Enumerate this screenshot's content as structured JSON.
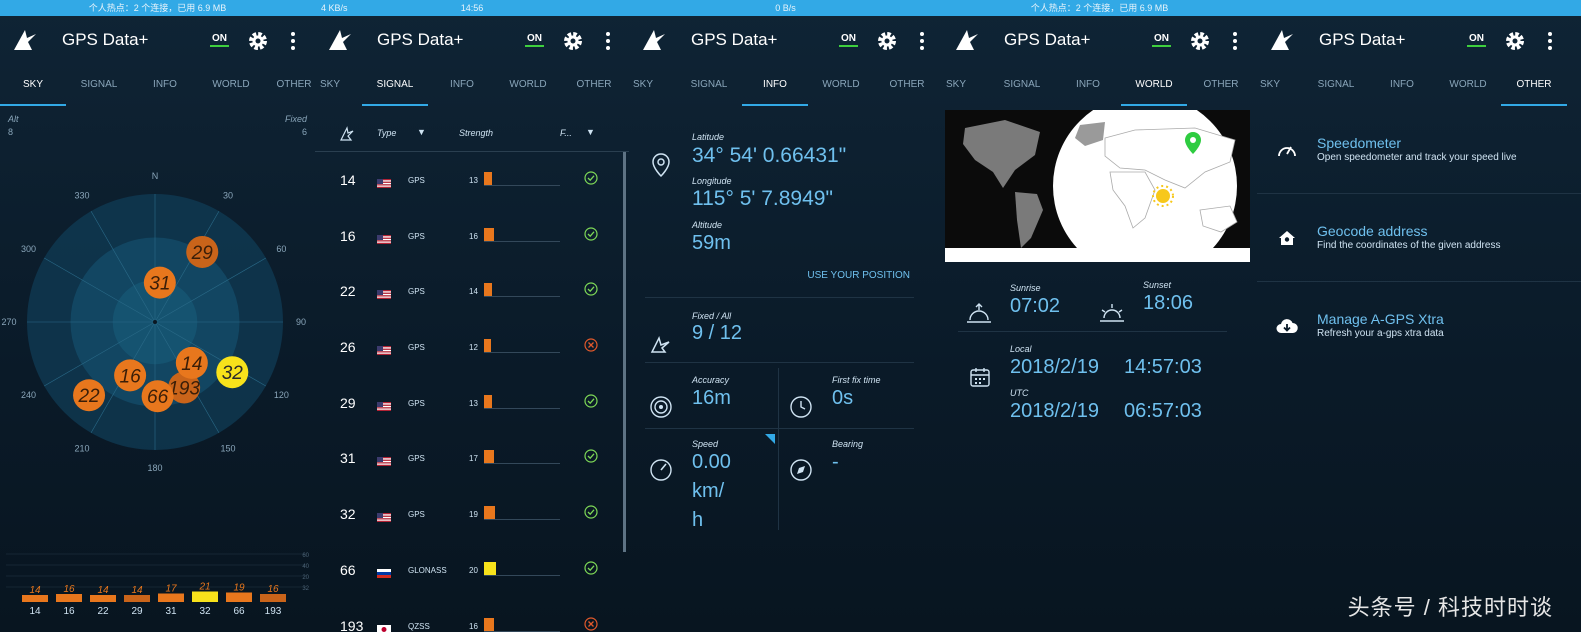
{
  "app": {
    "title": "GPS Data+",
    "on_label": "ON"
  },
  "tabs": [
    "SKY",
    "SIGNAL",
    "INFO",
    "WORLD",
    "OTHER"
  ],
  "status": {
    "hotspot": "个人热点：2 个连接，已用 6.9 MB",
    "speed": "4 KB/s",
    "time": "14:56",
    "speed2": "0 B/s"
  },
  "colors": {
    "accent": "#32a9e6",
    "orange": "#e8771d",
    "yellow": "#f7e21b",
    "green": "#7ed957",
    "red": "#e2592b",
    "bg": "#0a1722"
  },
  "sky": {
    "alt_label": "Alt",
    "alt_value": "8",
    "fixed_label": "Fixed",
    "fixed_value": "6",
    "azimuth_labels": [
      "210",
      "240",
      "270",
      "300",
      "330",
      "N",
      "30",
      "60",
      "90",
      "120",
      "150",
      "180"
    ],
    "satellites": [
      {
        "id": "193",
        "color": "#c9641a",
        "az": 156,
        "elev": 0.56
      },
      {
        "id": "66",
        "color": "#e8771d",
        "az": 178,
        "elev": 0.58
      },
      {
        "id": "16",
        "color": "#e8771d",
        "az": 205,
        "elev": 0.46
      },
      {
        "id": "22",
        "color": "#e8771d",
        "az": 222,
        "elev": 0.77
      },
      {
        "id": "32",
        "color": "#f7e21b",
        "az": 123,
        "elev": 0.72
      },
      {
        "id": "14",
        "color": "#e8771d",
        "az": 138,
        "elev": 0.43
      },
      {
        "id": "31",
        "color": "#e8771d",
        "az": 7,
        "elev": 0.31
      },
      {
        "id": "29",
        "color": "#c9641a",
        "az": 34,
        "elev": 0.66
      }
    ],
    "bar_scale": [
      "60",
      "40",
      "20",
      "32"
    ],
    "bars": [
      {
        "sat": "14",
        "strength": 14,
        "color": "#e8771d"
      },
      {
        "sat": "16",
        "strength": 16,
        "color": "#e8771d"
      },
      {
        "sat": "22",
        "strength": 14,
        "color": "#e8771d"
      },
      {
        "sat": "29",
        "strength": 14,
        "color": "#c9641a"
      },
      {
        "sat": "31",
        "strength": 17,
        "color": "#e8771d"
      },
      {
        "sat": "32",
        "strength": 21,
        "color": "#f7e21b"
      },
      {
        "sat": "66",
        "strength": 19,
        "color": "#e8771d"
      },
      {
        "sat": "193",
        "strength": 16,
        "color": "#c9641a"
      }
    ]
  },
  "signal": {
    "headers": {
      "type": "Type",
      "strength": "Strength",
      "fix": "F..."
    },
    "rows": [
      {
        "id": "14",
        "flag": "us",
        "type": "GPS",
        "strength": 13,
        "used": true,
        "color": "#e8771d"
      },
      {
        "id": "16",
        "flag": "us",
        "type": "GPS",
        "strength": 16,
        "used": true,
        "color": "#e8771d"
      },
      {
        "id": "22",
        "flag": "us",
        "type": "GPS",
        "strength": 14,
        "used": true,
        "color": "#e8771d"
      },
      {
        "id": "26",
        "flag": "us",
        "type": "GPS",
        "strength": 12,
        "used": false,
        "color": "#e8771d"
      },
      {
        "id": "29",
        "flag": "us",
        "type": "GPS",
        "strength": 13,
        "used": true,
        "color": "#e8771d"
      },
      {
        "id": "31",
        "flag": "us",
        "type": "GPS",
        "strength": 17,
        "used": true,
        "color": "#e8771d"
      },
      {
        "id": "32",
        "flag": "us",
        "type": "GPS",
        "strength": 19,
        "used": true,
        "color": "#e8771d"
      },
      {
        "id": "66",
        "flag": "ru",
        "type": "GLONASS",
        "strength": 20,
        "used": true,
        "color": "#f7e21b"
      },
      {
        "id": "193",
        "flag": "jp",
        "type": "QZSS",
        "strength": 16,
        "used": false,
        "color": "#e8771d"
      }
    ]
  },
  "info": {
    "latitude_label": "Latitude",
    "latitude": "34° 54' 0.66431\"",
    "longitude_label": "Longitude",
    "longitude": "115° 5' 7.8949\"",
    "altitude_label": "Altitude",
    "altitude": "59m",
    "use_position": "USE YOUR POSITION",
    "fixed_label": "Fixed / All",
    "fixed_value": "9 / 12",
    "accuracy_label": "Accuracy",
    "accuracy": "16m",
    "first_fix_label": "First fix time",
    "first_fix": "0s",
    "speed_label": "Speed",
    "speed_value": "0.00",
    "speed_unit1": "km/",
    "speed_unit2": "h",
    "bearing_label": "Bearing",
    "bearing": "-"
  },
  "world": {
    "sunrise_label": "Sunrise",
    "sunrise": "07:02",
    "sunset_label": "Sunset",
    "sunset": "18:06",
    "local_label": "Local",
    "local_date": "2018/2/19",
    "local_time": "14:57:03",
    "utc_label": "UTC",
    "utc_date": "2018/2/19",
    "utc_time": "06:57:03"
  },
  "other": [
    {
      "title": "Speedometer",
      "desc": "Open speedometer and track your speed live",
      "icon": "speedometer-icon"
    },
    {
      "title": "Geocode address",
      "desc": "Find the coordinates of the given address",
      "icon": "home-location-icon"
    },
    {
      "title": "Manage A-GPS Xtra",
      "desc": "Refresh your a-gps xtra data",
      "icon": "cloud-download-icon"
    }
  ],
  "watermark": "头条号 / 科技时时谈"
}
